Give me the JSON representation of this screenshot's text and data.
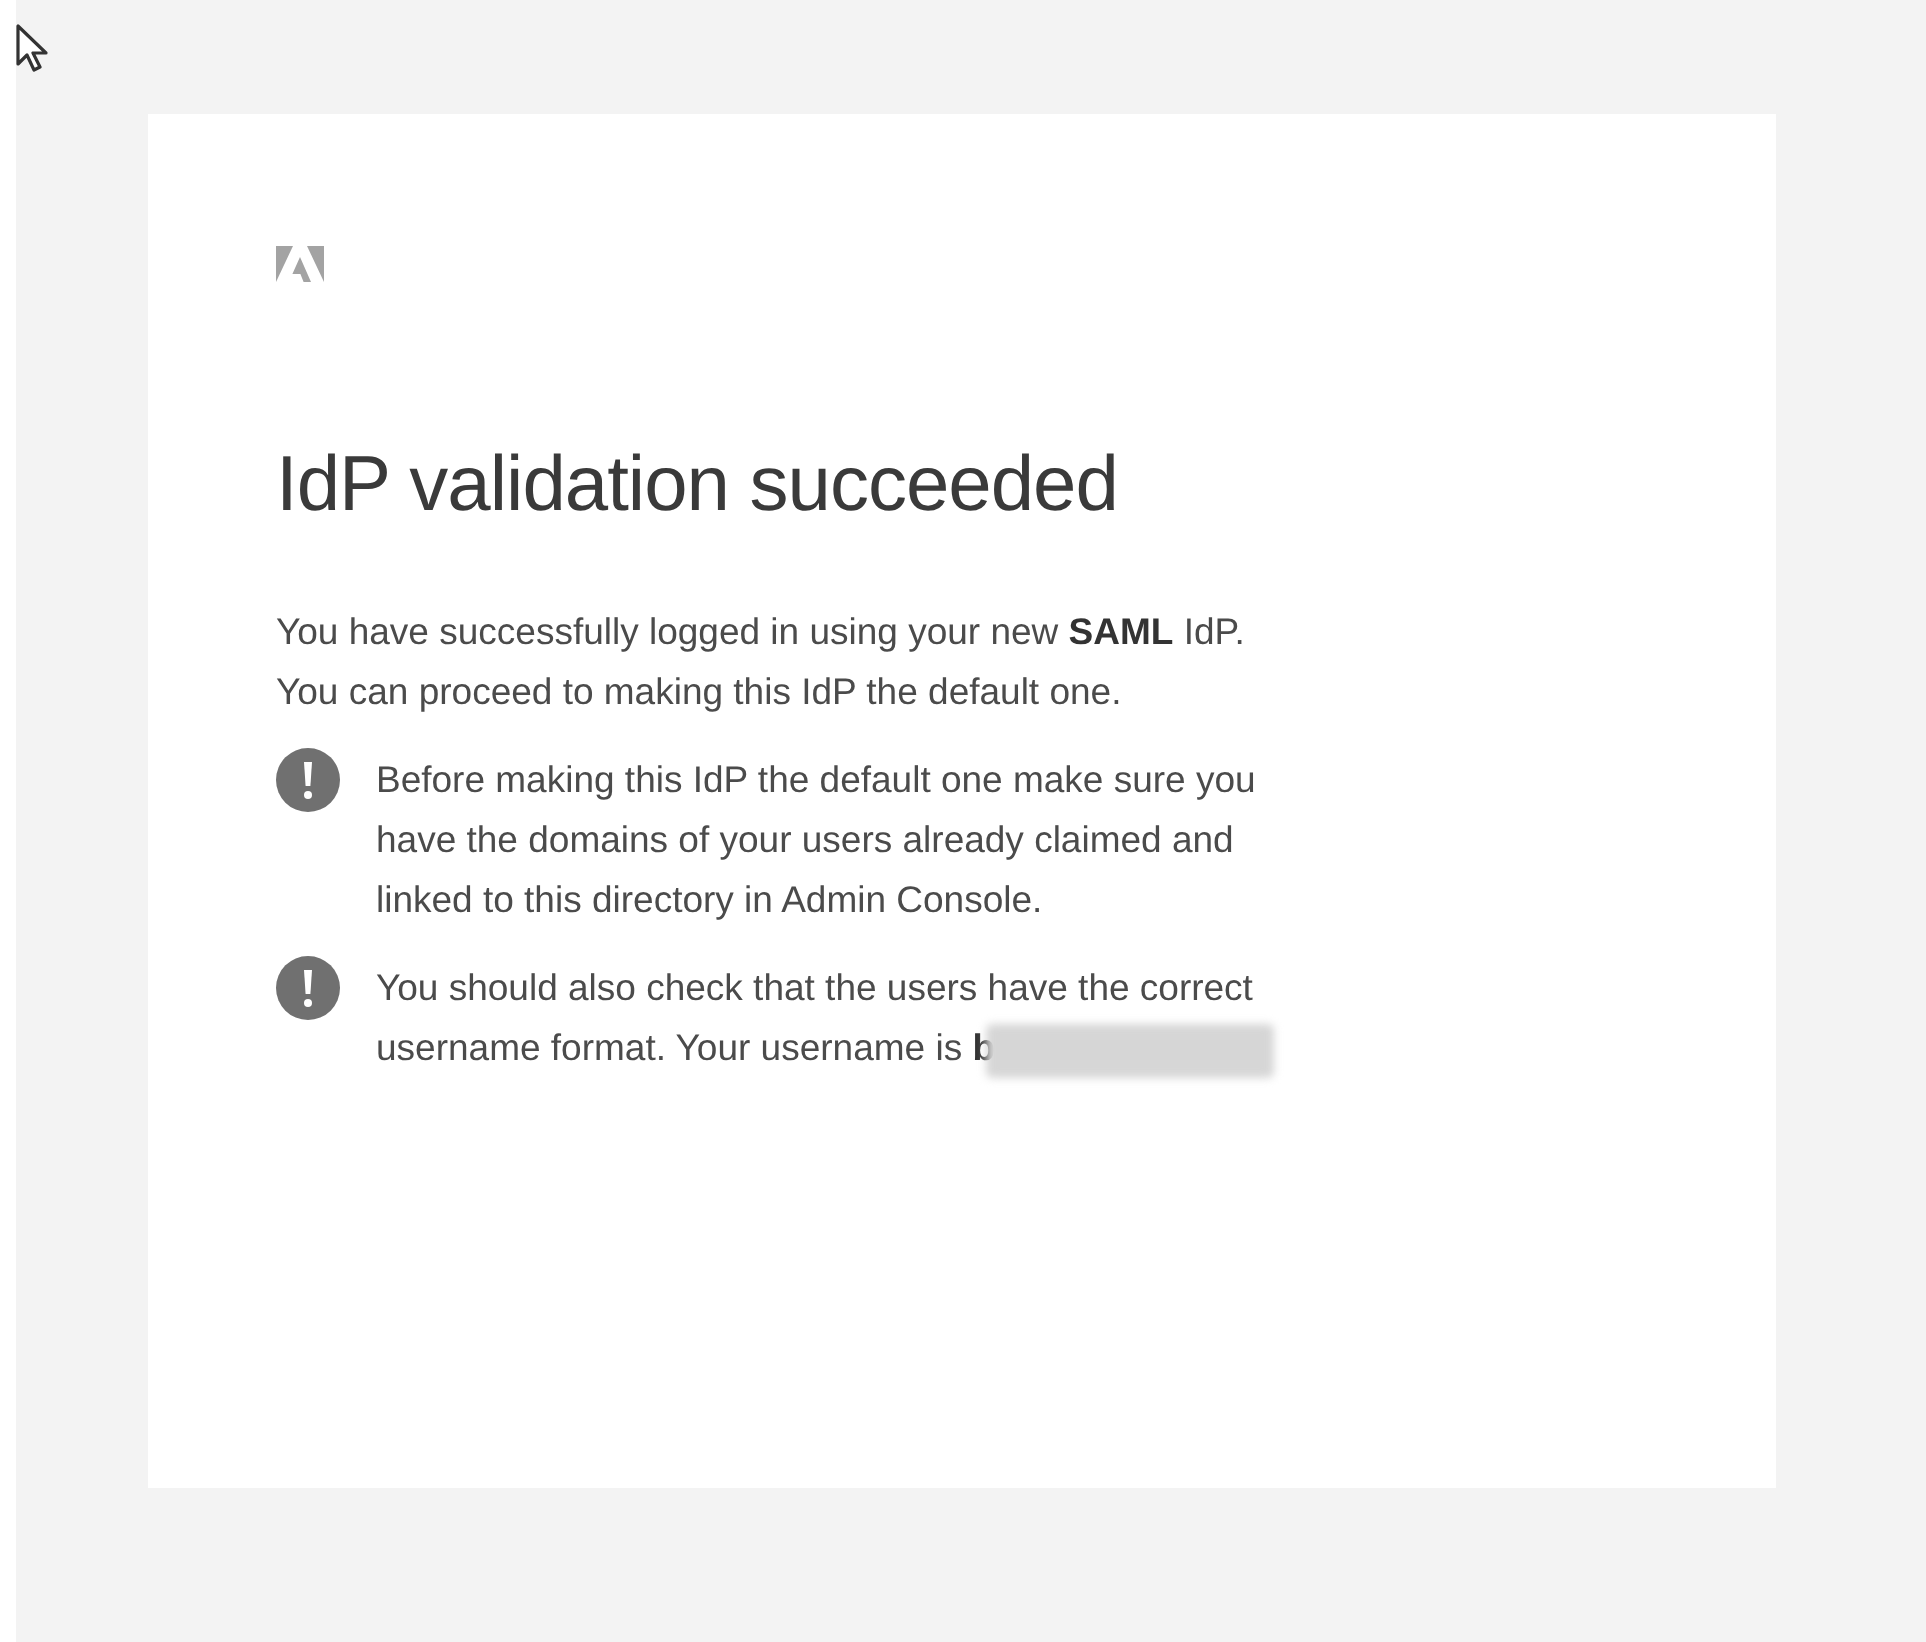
{
  "card": {
    "title": "IdP validation succeeded",
    "message_lines": [
      "You have successfully logged in using your new **SAML** IdP.",
      "You can proceed to making this IdP the default one."
    ],
    "notes": [
      {
        "kind": "warning",
        "lines": [
          "Before making this IdP the default one make sure you",
          "have the domains of your users already claimed and",
          "linked to this directory in Admin Console."
        ]
      },
      {
        "kind": "warning",
        "lines": [
          "You should also check that the users have the correct",
          "username format. Your username is **b**"
        ],
        "redacted": true
      }
    ]
  }
}
